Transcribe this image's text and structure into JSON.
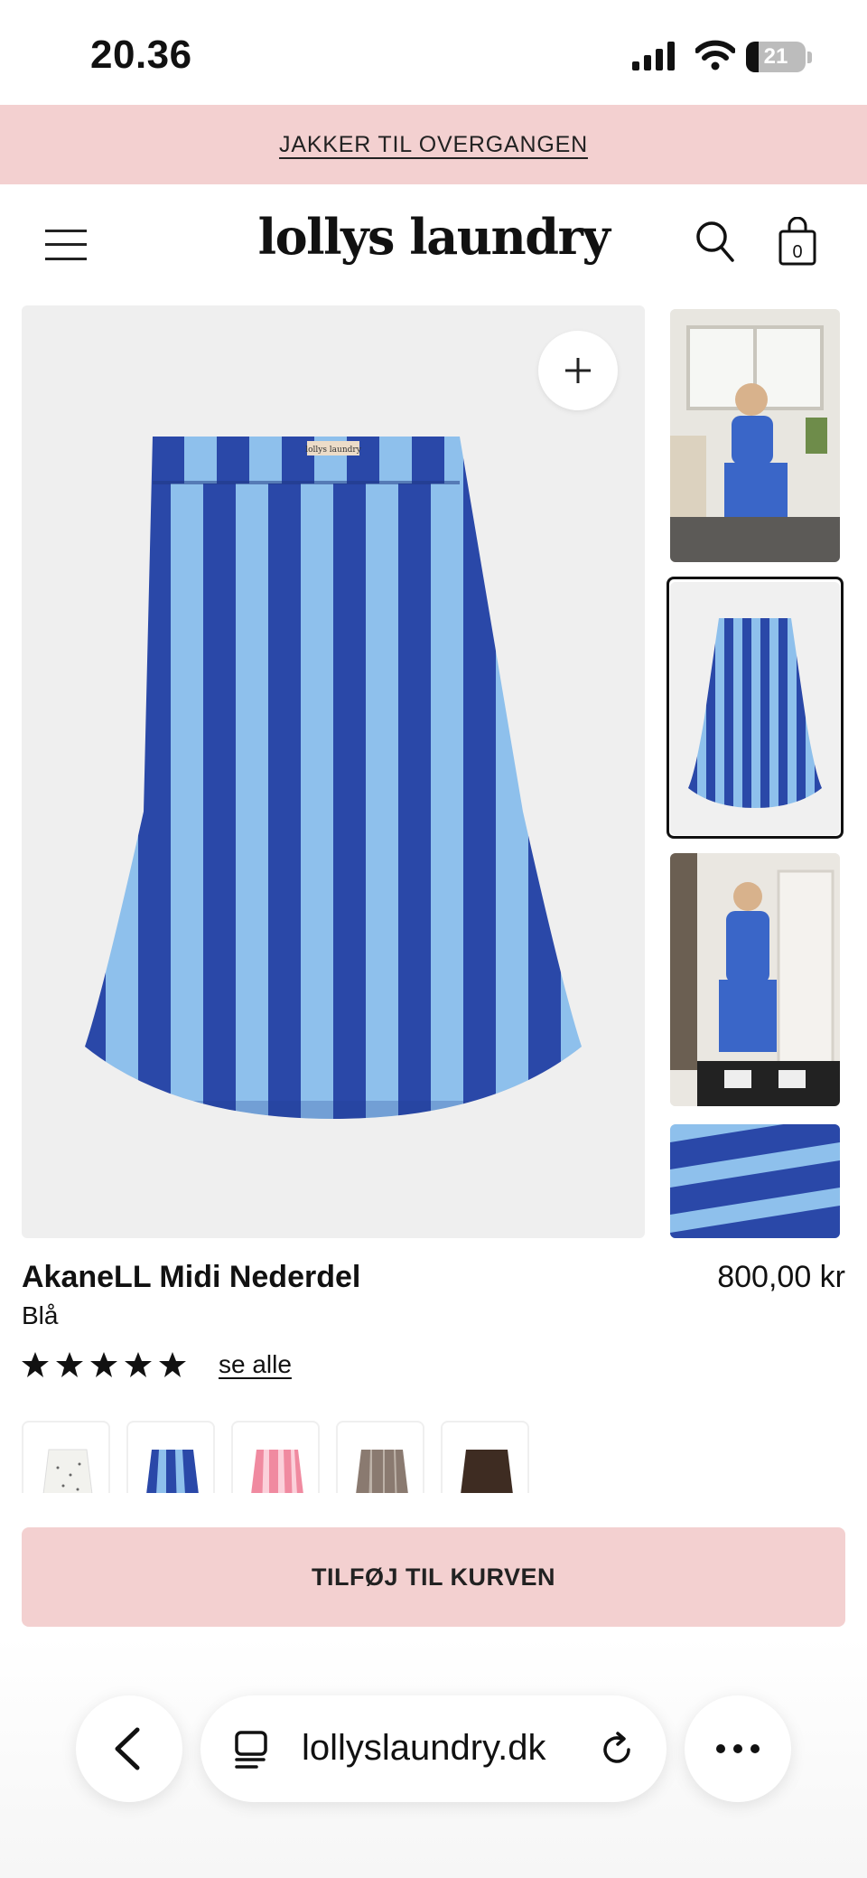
{
  "status_bar": {
    "time": "20.36",
    "battery_level": "21"
  },
  "promo": {
    "text": "JAKKER TIL OVERGANGEN"
  },
  "header": {
    "logo": "lollys laundry",
    "cart_count": "0"
  },
  "gallery": {
    "active_index": 1,
    "thumbnails": [
      "lifestyle-sitting",
      "product-skirt",
      "lifestyle-standing",
      "fabric-detail"
    ],
    "main_label": "lollys laundry"
  },
  "product": {
    "name": "AkaneLL Midi Nederdel",
    "price": "800,00 kr",
    "color": "Blå",
    "rating": 5,
    "see_all": "se alle"
  },
  "swatches": [
    {
      "name": "white-dots",
      "color": "#f2f2ee"
    },
    {
      "name": "blue-stripe",
      "color": "#3a66c8"
    },
    {
      "name": "pink-stripe",
      "color": "#f08aa0"
    },
    {
      "name": "brown-stripe",
      "color": "#8a7a70"
    },
    {
      "name": "dark-brown",
      "color": "#3e2c22"
    }
  ],
  "cart_button": {
    "label": "TILFØJ TIL KURVEN"
  },
  "browser": {
    "url": "lollyslaundry.dk"
  },
  "colors": {
    "accent_pink": "#f3d0d0",
    "stripe_dark": "#2a48a8",
    "stripe_light": "#8ec0ec"
  }
}
